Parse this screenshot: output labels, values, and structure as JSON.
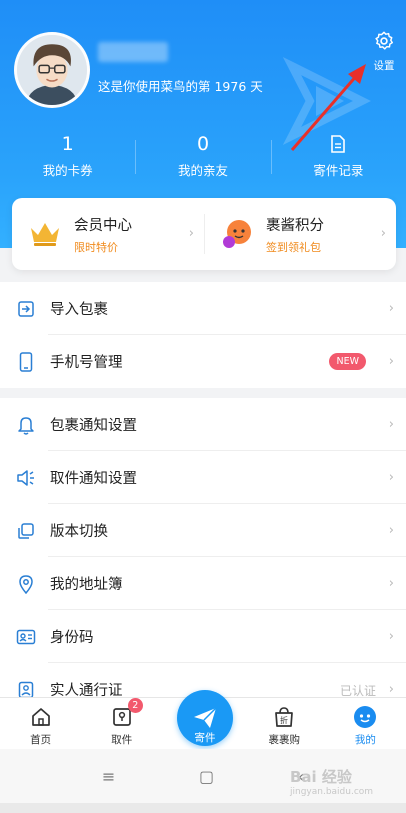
{
  "header": {
    "tagline": "这是你使用菜鸟的第 1976 天",
    "settings_label": "设置"
  },
  "stats": [
    {
      "value": "1",
      "label": "我的卡券"
    },
    {
      "value": "0",
      "label": "我的亲友"
    },
    {
      "icon": "document-icon",
      "label": "寄件记录"
    }
  ],
  "member_card": {
    "left": {
      "title": "会员中心",
      "subtitle": "限时特价",
      "icon": "crown-icon"
    },
    "right": {
      "title": "裹酱积分",
      "subtitle": "签到领礼包",
      "icon": "mascot-icon"
    }
  },
  "section1": [
    {
      "label": "导入包裹",
      "icon": "import-icon"
    },
    {
      "label": "手机号管理",
      "icon": "phone-icon",
      "badge": "NEW"
    }
  ],
  "section2": [
    {
      "label": "包裹通知设置",
      "icon": "bell-icon"
    },
    {
      "label": "取件通知设置",
      "icon": "speaker-icon"
    },
    {
      "label": "版本切换",
      "icon": "switch-icon"
    },
    {
      "label": "我的地址簿",
      "icon": "location-icon"
    },
    {
      "label": "身份码",
      "icon": "id-card-icon"
    },
    {
      "label": "实人通行证",
      "icon": "person-card-icon",
      "status": "已认证"
    }
  ],
  "tabbar": {
    "tabs": [
      {
        "label": "首页",
        "icon": "home-icon"
      },
      {
        "label": "取件",
        "icon": "pickup-icon",
        "badge": "2"
      },
      {
        "label": "寄件",
        "icon": "send-icon"
      },
      {
        "label": "裹裹购",
        "icon": "shopping-bag-icon"
      },
      {
        "label": "我的",
        "icon": "profile-icon",
        "active": true
      }
    ]
  },
  "watermark": {
    "brand": "Bai 经验",
    "url": "jingyan.baidu.com"
  },
  "colors": {
    "primary": "#1a8cf0",
    "header_gradient_start": "#1f8ef7",
    "badge": "#f2596d",
    "accent_orange": "#f08a1c"
  }
}
